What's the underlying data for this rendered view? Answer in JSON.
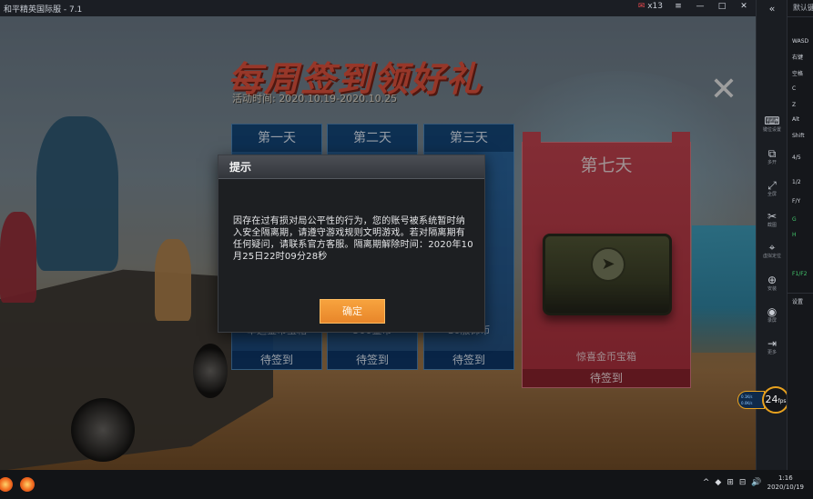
{
  "window": {
    "title": "和平精英国际服 - 7.1",
    "badge": "13",
    "buttons": [
      "≡",
      "—",
      "□",
      "✕"
    ]
  },
  "banner": {
    "title": "每周签到领好礼",
    "date": "活动时间: 2020.10.19-2020.10.25"
  },
  "cards": [
    {
      "day": "第一天",
      "reward": "幸运金币宝箱",
      "status": "待签到"
    },
    {
      "day": "第二天",
      "reward": "500金币",
      "status": "待签到"
    },
    {
      "day": "第三天",
      "reward": "10服饰币",
      "status": "待签到"
    }
  ],
  "card7": {
    "day": "第七天",
    "reward": "惊喜金币宝箱",
    "status": "待签到"
  },
  "dialog": {
    "title": "提示",
    "message": "因存在过有损对局公平性的行为，您的账号被系统暂时纳入安全隔离期，请遵守游戏规则文明游戏。若对隔离期有任何疑问，请联系官方客服。隔离期解除时间：2020年10月25日22时09分28秒",
    "confirm": "确定"
  },
  "sidebar": {
    "collapse": "«",
    "items": [
      {
        "glyph": "⌨",
        "label": "键位设置"
      },
      {
        "glyph": "⧉",
        "label": "多开"
      },
      {
        "glyph": "⤢",
        "label": "全屏"
      },
      {
        "glyph": "✂",
        "label": "截图"
      },
      {
        "glyph": "⌖",
        "label": "虚拟定位"
      },
      {
        "glyph": "⊕",
        "label": "安装"
      },
      {
        "glyph": "◉",
        "label": "录屏"
      },
      {
        "glyph": "⇥",
        "label": "更多"
      }
    ]
  },
  "fps": {
    "value": "24",
    "unit": "fps",
    "net_up": "0.1K/s",
    "net_down": "0.0K/s"
  },
  "panel": {
    "title": "默认键位",
    "items": [
      "WASD",
      "右键",
      "空格",
      "C",
      "Z",
      "Alt",
      "Shift",
      "4/5",
      "1/2",
      "F/Y",
      "G",
      "H",
      "F1/F2",
      "设置"
    ]
  },
  "taskbar": {
    "time": "1:16",
    "date": "2020/10/19",
    "tray_icons": [
      "^",
      "◆",
      "⊞",
      "⊟",
      "🔊"
    ]
  }
}
